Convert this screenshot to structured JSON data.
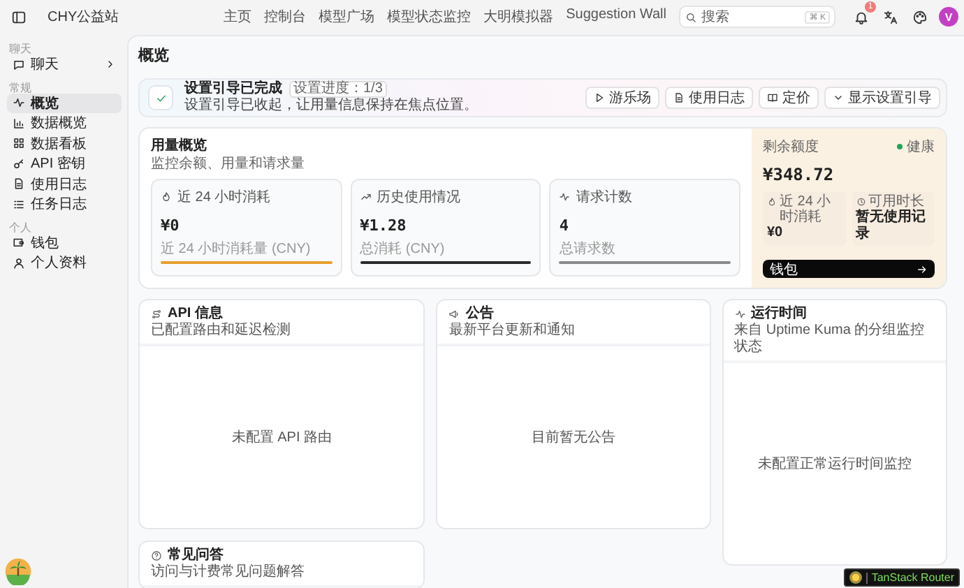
{
  "topbar": {
    "site_title": "CHY公益站",
    "nav": [
      {
        "label": "主页",
        "selected": false
      },
      {
        "label": "控制台",
        "selected": false
      },
      {
        "label": "模型广场",
        "selected": false
      },
      {
        "label": "模型状态监控",
        "selected": false
      },
      {
        "label": "大明模拟器",
        "selected": false
      },
      {
        "label": "Suggestion Wall",
        "selected": false
      }
    ],
    "search": {
      "placeholder": "搜索",
      "shortcut": "⌘ K"
    },
    "notification_count": "1",
    "avatar_letter": "V"
  },
  "sidebar": {
    "sections": [
      {
        "title": "聊天",
        "items": [
          {
            "label": "聊天",
            "selected": false,
            "expandable": true
          }
        ]
      },
      {
        "title": "常规",
        "items": [
          {
            "label": "概览",
            "selected": true,
            "expandable": false
          },
          {
            "label": "数据概览",
            "selected": false,
            "expandable": false
          },
          {
            "label": "数据看板",
            "selected": false,
            "expandable": false
          },
          {
            "label": "API 密钥",
            "selected": false,
            "expandable": false
          },
          {
            "label": "使用日志",
            "selected": false,
            "expandable": false
          },
          {
            "label": "任务日志",
            "selected": false,
            "expandable": false
          }
        ]
      },
      {
        "title": "个人",
        "items": [
          {
            "label": "钱包",
            "selected": false,
            "expandable": false
          },
          {
            "label": "个人资料",
            "selected": false,
            "expandable": false
          }
        ]
      }
    ]
  },
  "page_title": "概览",
  "setup_banner": {
    "title": "设置引导已完成",
    "badge": "设置进度：1/3",
    "text": "设置引导已收起，让用量信息保持在焦点位置。",
    "buttons": [
      "游乐场",
      "使用日志",
      "定价",
      "显示设置引导"
    ]
  },
  "usage": {
    "title": "用量概览",
    "subtitle": "监控余额、用量和请求量",
    "stats": [
      {
        "label": "近 24 小时消耗",
        "value": "¥0",
        "caption": "近 24 小时消耗量 (CNY)",
        "color": "#e8a030"
      },
      {
        "label": "历史使用情况",
        "value": "¥1.28",
        "caption": "总消耗 (CNY)",
        "color": "#2b2b2b"
      },
      {
        "label": "请求计数",
        "value": "4",
        "caption": "总请求数",
        "color": "#8a8a8a"
      }
    ],
    "balance": {
      "label": "剩余额度",
      "status": "健康",
      "value": "¥348.72",
      "details": [
        {
          "label": "近 24 小时消耗",
          "value": "¥0"
        },
        {
          "label": "可用时长",
          "value": "暂无使用记录"
        }
      ],
      "button": "钱包"
    }
  },
  "panel_columns": [
    {
      "panels": [
        {
          "title": "API 信息",
          "subtitle": "已配置路由和延迟检测",
          "empty_text": "未配置 API 路由"
        },
        {
          "title": "常见问答",
          "subtitle": "访问与计费常见问题解答"
        }
      ]
    },
    {
      "panels": [
        {
          "title": "公告",
          "subtitle": "最新平台更新和通知",
          "empty_text": "目前暂无公告"
        }
      ]
    },
    {
      "panels": [
        {
          "title": "运行时间",
          "subtitle": "来自 Uptime Kuma 的分组监控状态",
          "empty_text": "未配置正常运行时间监控"
        }
      ]
    }
  ],
  "devtools_button": "TanStack Router"
}
